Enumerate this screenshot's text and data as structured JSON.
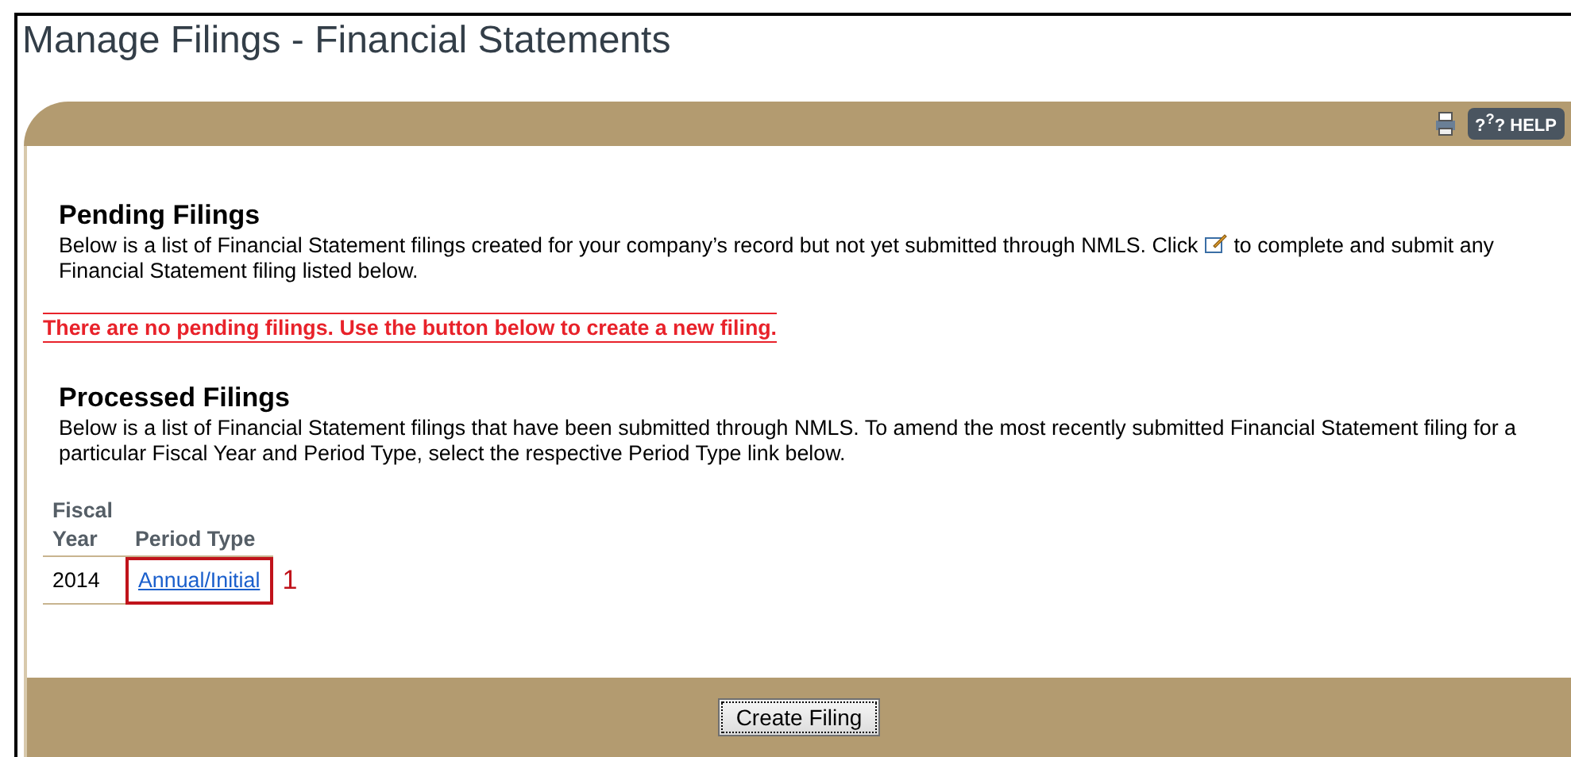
{
  "title": "Manage Filings - Financial Statements",
  "toolbar": {
    "help_label": "?$^{?}$? HELP"
  },
  "pending": {
    "heading": "Pending Filings",
    "text_before": "Below is a list of Financial Statement filings created for your company’s record but not yet submitted through NMLS. Click",
    "text_after": "to complete and submit any Financial Statement filing listed below.",
    "message": "There are no pending filings. Use the button below to create a new filing."
  },
  "processed": {
    "heading": "Processed Filings",
    "text": "Below is a list of Financial Statement filings that have been submitted through NMLS. To amend the most recently submitted Financial Statement filing for a particular Fiscal Year and Period Type, select the respective Period Type link below.",
    "table": {
      "columns": [
        "Fiscal Year",
        "Period Type"
      ],
      "rows": [
        {
          "fiscal_year": "2014",
          "period_type": "Annual/Initial",
          "callout": "1"
        }
      ]
    }
  },
  "footer": {
    "button": "Create Filing"
  }
}
